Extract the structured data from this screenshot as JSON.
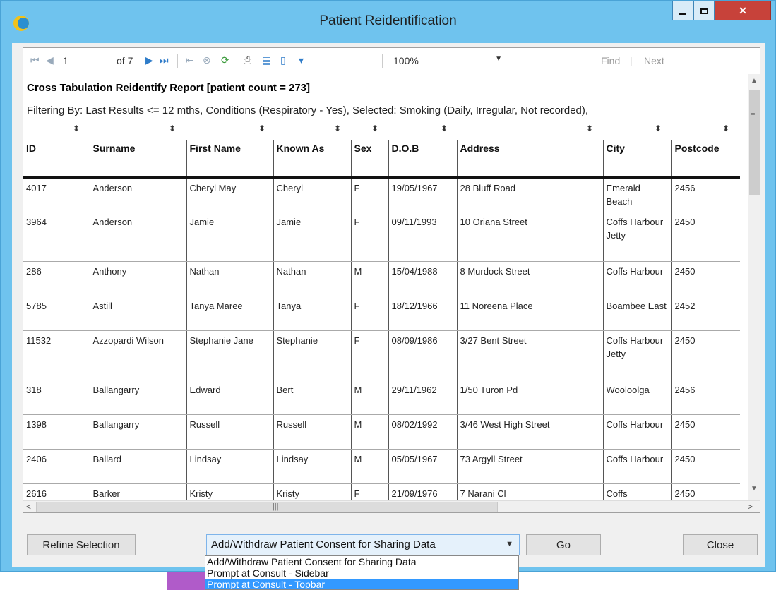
{
  "window": {
    "title": "Patient Reidentification",
    "icons": {
      "app": "app-icon",
      "minimize": "minimize-icon",
      "maximize": "maximize-icon",
      "close": "close-icon"
    }
  },
  "toolbar": {
    "page_current": "1",
    "page_total": "of 7",
    "zoom": "100%",
    "find_label": "Find",
    "separator": "|",
    "next_label": "Next",
    "icons": [
      "first-page-icon",
      "prev-page-icon",
      "next-page-icon",
      "last-page-icon",
      "back-icon",
      "stop-icon",
      "refresh-icon",
      "print-icon",
      "print-layout-icon",
      "page-setup-icon",
      "export-icon"
    ]
  },
  "report": {
    "title": "Cross Tabulation Reidentify Report  [patient count = 273]",
    "filter": "Filtering By: Last Results <= 12 mths, Conditions (Respiratory - Yes), Selected: Smoking (Daily, Irregular, Not recorded),",
    "columns": [
      "ID",
      "Surname",
      "First Name",
      "Known As",
      "Sex",
      "D.O.B",
      "Address",
      "City",
      "Postcode"
    ],
    "rows": [
      [
        "4017",
        "Anderson",
        "Cheryl May",
        "Cheryl",
        "F",
        "19/05/1967",
        "28 Bluff Road",
        "Emerald Beach",
        "2456"
      ],
      [
        "3964",
        "Anderson",
        "Jamie",
        "Jamie",
        "F",
        "09/11/1993",
        "10 Oriana Street",
        "Coffs Harbour Jetty",
        "2450"
      ],
      [
        "286",
        "Anthony",
        "Nathan",
        "Nathan",
        "M",
        "15/04/1988",
        "8 Murdock Street",
        "Coffs Harbour",
        "2450"
      ],
      [
        "5785",
        "Astill",
        "Tanya Maree",
        "Tanya",
        "F",
        "18/12/1966",
        "11 Noreena Place",
        "Boambee East",
        "2452"
      ],
      [
        "11532",
        "Azzopardi Wilson",
        "Stephanie Jane",
        "Stephanie",
        "F",
        "08/09/1986",
        "3/27 Bent Street",
        "Coffs Harbour Jetty",
        "2450"
      ],
      [
        "318",
        "Ballangarry",
        "Edward",
        "Bert",
        "M",
        "29/11/1962",
        "1/50 Turon Pd",
        "Wooloolga",
        "2456"
      ],
      [
        "1398",
        "Ballangarry",
        "Russell",
        "Russell",
        "M",
        "08/02/1992",
        "3/46 West High Street",
        "Coffs Harbour",
        "2450"
      ],
      [
        "2406",
        "Ballard",
        "Lindsay",
        "Lindsay",
        "M",
        "05/05/1967",
        "73 Argyll Street",
        "Coffs Harbour",
        "2450"
      ],
      [
        "2616",
        "Barker",
        "Kristy",
        "Kristy",
        "F",
        "21/09/1976",
        "7 Narani Cl",
        "Coffs",
        "2450"
      ]
    ]
  },
  "buttons": {
    "refine": "Refine Selection",
    "go": "Go",
    "close": "Close"
  },
  "consent_combo": {
    "selected": "Add/Withdraw Patient Consent for Sharing Data",
    "options": [
      "Add/Withdraw Patient Consent for Sharing Data",
      "Prompt at Consult - Sidebar",
      "Prompt at Consult - Topbar"
    ],
    "highlighted_index": 2
  },
  "colors": {
    "titlebar": "#6fc3ee",
    "close_button": "#c7423a",
    "selection": "#3399ff",
    "combo_bg": "#e5f1fb"
  }
}
